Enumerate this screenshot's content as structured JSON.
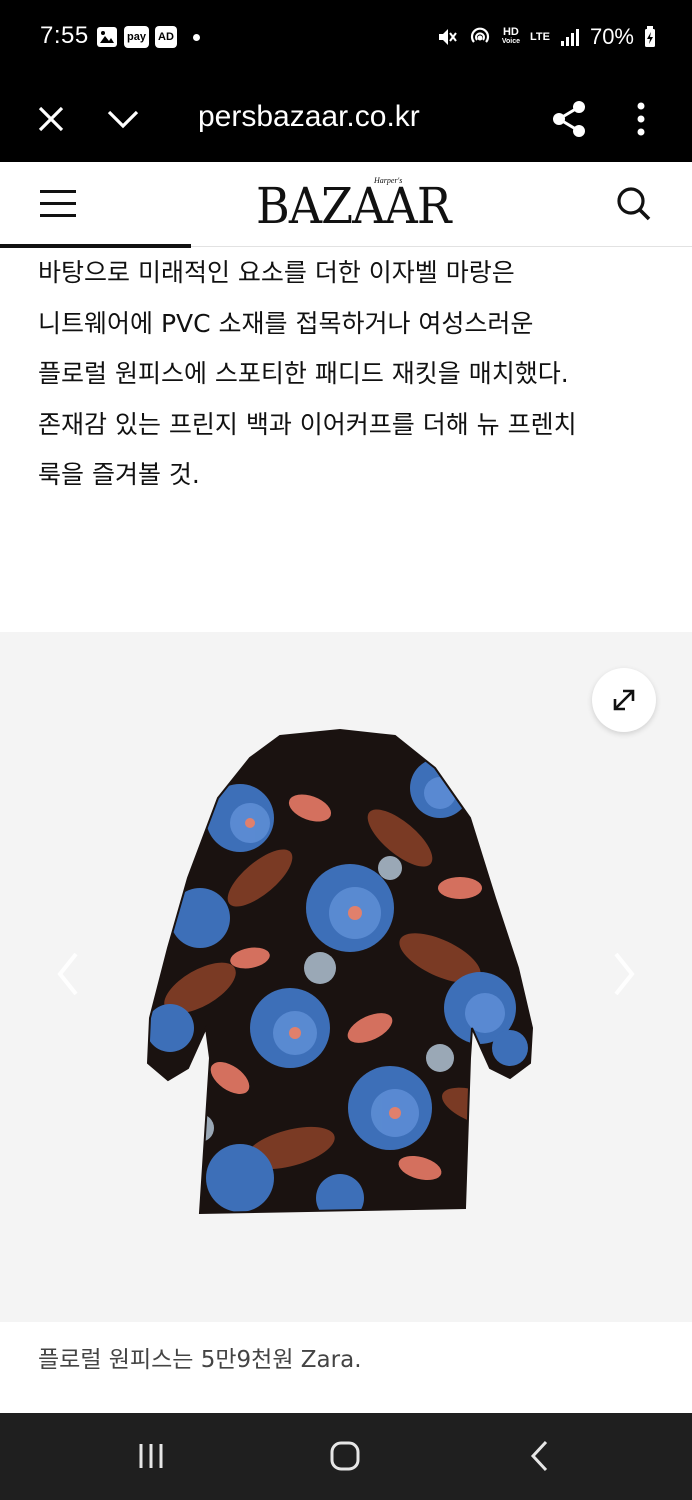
{
  "status_bar": {
    "time": "7:55",
    "badges": [
      "pay",
      "AD"
    ],
    "hd_label": "HD",
    "voice_label": "Voice",
    "lte_label": "LTE",
    "battery": "70%"
  },
  "browser": {
    "url": "persbazaar.co.kr"
  },
  "site": {
    "logo": "BAZAAR",
    "logo_small": "Harper's"
  },
  "article": {
    "lines": [
      "바탕으로 미래적인 요소를 더한 이자벨 마랑은",
      "니트웨어에 PVC 소재를 접목하거나 여성스러운",
      "플로럴 원피스에 스포티한 패디드 재킷을 매치했다.",
      "존재감 있는 프린지 백과 이어커프를 더해 뉴 프렌치",
      "룩을 즐겨볼 것."
    ]
  },
  "carousel": {
    "image_alt": "floral-dress-image"
  },
  "caption": "플로럴 원피스는 5만9천원 Zara.",
  "icons": {
    "close": "close-icon",
    "chevron": "chevron-down-icon",
    "share": "share-icon",
    "more": "more-vert-icon",
    "menu": "hamburger-icon",
    "search": "search-icon",
    "expand": "expand-icon"
  }
}
